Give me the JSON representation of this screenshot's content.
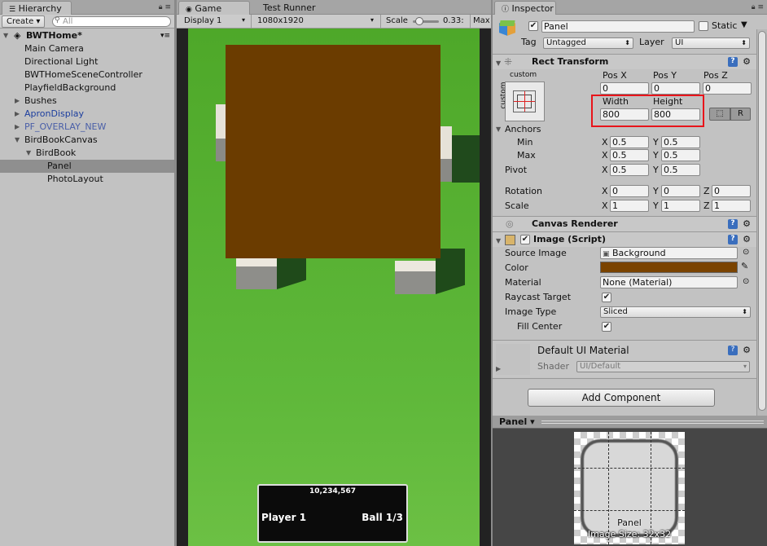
{
  "hierarchy": {
    "tab_label": "Hierarchy",
    "create_label": "Create ▾",
    "search_placeholder": "All",
    "scene_name": "BWTHome*",
    "items": [
      {
        "label": "Main Camera"
      },
      {
        "label": "Directional Light"
      },
      {
        "label": "BWTHomeSceneController"
      },
      {
        "label": "PlayfieldBackground"
      },
      {
        "label": "Bushes"
      },
      {
        "label": "ApronDisplay"
      },
      {
        "label": "PF_OVERLAY_NEW"
      },
      {
        "label": "BirdBookCanvas"
      },
      {
        "label": "BirdBook"
      },
      {
        "label": "Panel"
      },
      {
        "label": "PhotoLayout"
      }
    ]
  },
  "game": {
    "tab_game": "Game",
    "tab_test_runner": "Test Runner",
    "display_label": "Display 1",
    "resolution_label": "1080x1920",
    "scale_label": "Scale",
    "scale_value": "0.33:",
    "maximize_label": "Max",
    "scale_fraction": 0.15,
    "hud": {
      "score": "10,234,567",
      "player": "Player 1",
      "ball": "Ball 1/3"
    }
  },
  "inspector": {
    "tab_label": "Inspector",
    "object_name": "Panel",
    "static_label": "Static",
    "tag_label": "Tag",
    "tag_value": "Untagged",
    "layer_label": "Layer",
    "layer_value": "UI",
    "rect_transform": {
      "title": "Rect Transform",
      "anchor_preset_top": "custom",
      "anchor_preset_side": "custom",
      "pos_x_label": "Pos X",
      "pos_y_label": "Pos Y",
      "pos_z_label": "Pos Z",
      "pos_x": "0",
      "pos_y": "0",
      "pos_z": "0",
      "width_label": "Width",
      "height_label": "Height",
      "width": "800",
      "height": "800",
      "r_button": "R",
      "anchors_label": "Anchors",
      "min_label": "Min",
      "max_label": "Max",
      "pivot_label": "Pivot",
      "rotation_label": "Rotation",
      "scale_label": "Scale",
      "anchor_min_x": "0.5",
      "anchor_min_y": "0.5",
      "anchor_max_x": "0.5",
      "anchor_max_y": "0.5",
      "pivot_x": "0.5",
      "pivot_y": "0.5",
      "rot_x": "0",
      "rot_y": "0",
      "rot_z": "0",
      "scale_x": "1",
      "scale_y": "1",
      "scale_z": "1",
      "x_label": "X",
      "y_label": "Y",
      "z_label": "Z"
    },
    "canvas_renderer": {
      "title": "Canvas Renderer"
    },
    "image_script": {
      "title": "Image (Script)",
      "source_image_label": "Source Image",
      "source_image_value": "Background",
      "color_label": "Color",
      "color_value": "#7a4300",
      "material_label": "Material",
      "material_value": "None (Material)",
      "raycast_label": "Raycast Target",
      "image_type_label": "Image Type",
      "image_type_value": "Sliced",
      "fill_center_label": "Fill Center"
    },
    "default_material": {
      "title": "Default UI Material",
      "shader_label": "Shader",
      "shader_value": "UI/Default"
    },
    "add_component_label": "Add Component",
    "preview": {
      "header_label": "Panel ▾",
      "caption_name": "Panel",
      "caption_size": "Image Size: 32x32"
    }
  },
  "colors": {
    "highlight": "#e8141a",
    "field_green": "#5ab433",
    "panel_brown": "#6b3c00"
  }
}
